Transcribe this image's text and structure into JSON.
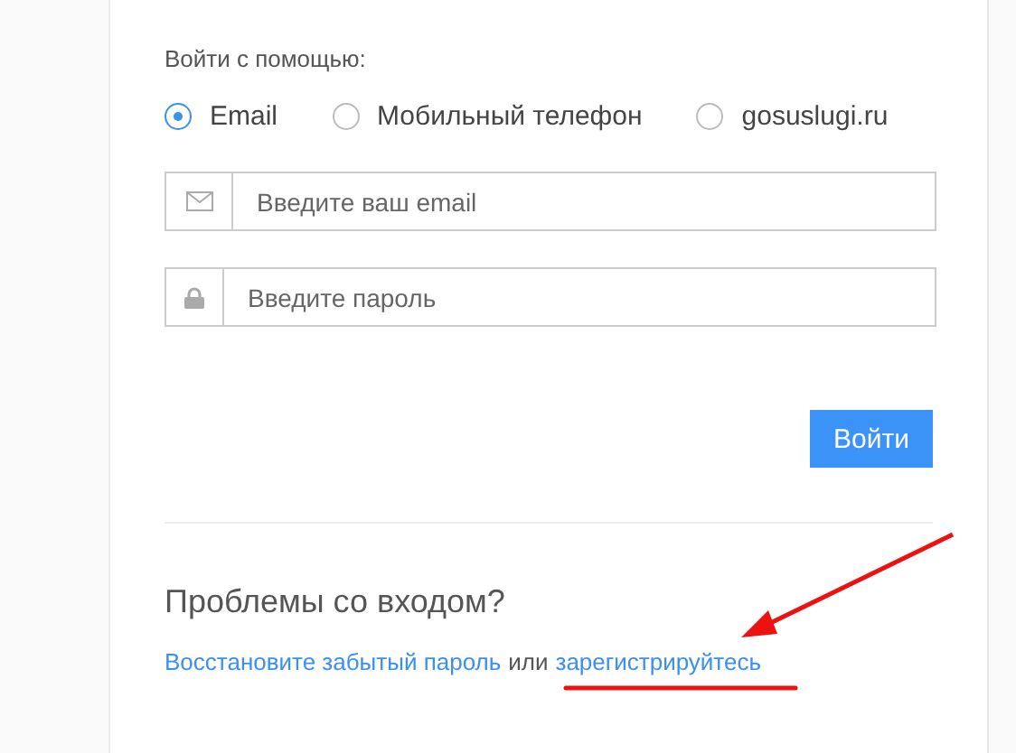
{
  "login_label": "Войти с помощью:",
  "methods": [
    {
      "label": "Email",
      "selected": true
    },
    {
      "label": "Мобильный телефон",
      "selected": false
    },
    {
      "label": "gosuslugi.ru",
      "selected": false
    }
  ],
  "fields": [
    {
      "kind": "email",
      "placeholder": "Введите ваш email"
    },
    {
      "kind": "password",
      "placeholder": "Введите пароль"
    }
  ],
  "submit": "Войти",
  "problems_title": "Проблемы со входом?",
  "help": {
    "restore_link": "Восстановите забытый пароль",
    "or": "или",
    "register_link": "зарегистрируйтесь"
  }
}
